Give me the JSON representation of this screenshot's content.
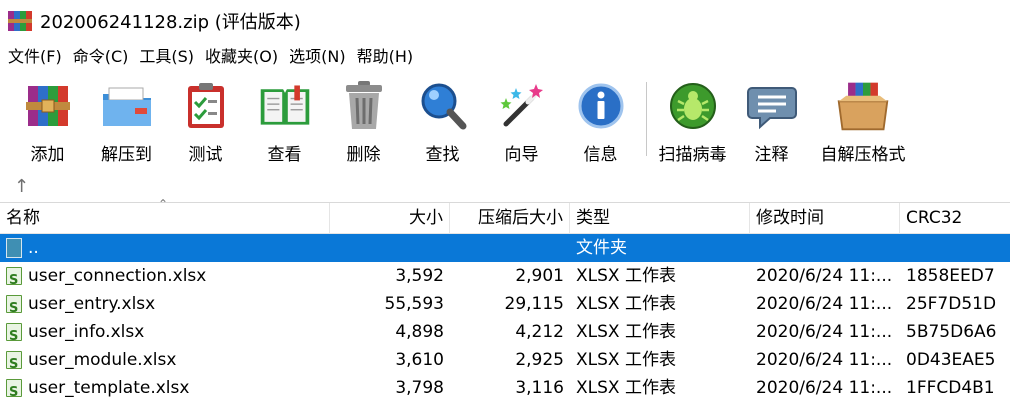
{
  "window": {
    "title": "202006241128.zip (评估版本)"
  },
  "menu": [
    "文件(F)",
    "命令(C)",
    "工具(S)",
    "收藏夹(O)",
    "选项(N)",
    "帮助(H)"
  ],
  "toolbar": {
    "add": "添加",
    "extract": "解压到",
    "test": "测试",
    "view": "查看",
    "delete": "删除",
    "find": "查找",
    "wizard": "向导",
    "info": "信息",
    "scan": "扫描病毒",
    "comment": "注释",
    "sfx": "自解压格式"
  },
  "columns": {
    "name": "名称",
    "size": "大小",
    "packed": "压缩后大小",
    "type": "类型",
    "modified": "修改时间",
    "crc": "CRC32"
  },
  "parent_row": {
    "name": "..",
    "type": "文件夹"
  },
  "files": [
    {
      "name": "user_connection.xlsx",
      "size": "3,592",
      "packed": "2,901",
      "type": "XLSX 工作表",
      "modified": "2020/6/24 11:...",
      "crc": "1858EED7"
    },
    {
      "name": "user_entry.xlsx",
      "size": "55,593",
      "packed": "29,115",
      "type": "XLSX 工作表",
      "modified": "2020/6/24 11:...",
      "crc": "25F7D51D"
    },
    {
      "name": "user_info.xlsx",
      "size": "4,898",
      "packed": "4,212",
      "type": "XLSX 工作表",
      "modified": "2020/6/24 11:...",
      "crc": "5B75D6A6"
    },
    {
      "name": "user_module.xlsx",
      "size": "3,610",
      "packed": "2,925",
      "type": "XLSX 工作表",
      "modified": "2020/6/24 11:...",
      "crc": "0D43EAE5"
    },
    {
      "name": "user_template.xlsx",
      "size": "3,798",
      "packed": "3,116",
      "type": "XLSX 工作表",
      "modified": "2020/6/24 11:...",
      "crc": "1FFCD4B1"
    }
  ]
}
